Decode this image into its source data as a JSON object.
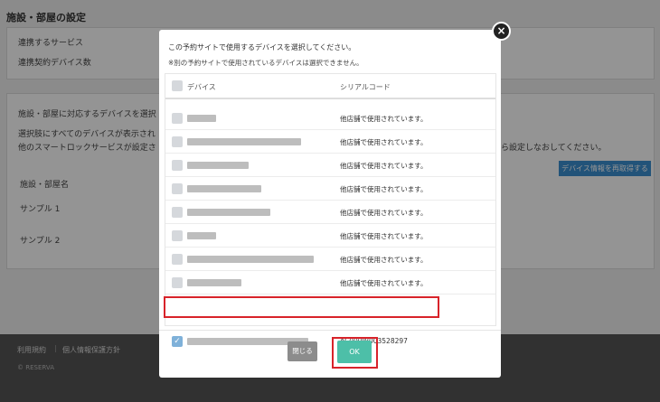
{
  "background": {
    "title": "施設・部屋の設定",
    "labels": {
      "linked_service": "連携するサービス",
      "linked_device_count": "連携契約デバイス数",
      "select_device_prompt": "施設・部屋に対応するデバイスを選択",
      "no_device_note_1": "選択肢にすべてのデバイスが表示され",
      "no_device_note_2": "他のスマートロックサービスが設定さ",
      "reconfigure_note": "ら設定しなおしてください。",
      "facility_room_name": "施設・部屋名",
      "sample1": "サンプル 1",
      "sample2": "サンプル 2"
    },
    "update_device_button": "デバイス情報を再取得する",
    "footer": {
      "terms": "利用規約",
      "privacy": "個人情報保護方針",
      "copyright": "© RESERVA"
    }
  },
  "modal": {
    "close_symbol": "×",
    "message_line1": "この予約サイトで使用するデバイスを選択してください。",
    "message_line2": "※別の予約サイトで使用されているデバイスは選択できません。",
    "header": {
      "device": "デバイス",
      "serial": "シリアルコード"
    },
    "rows": [
      {
        "status": "他店舗で使用されています。",
        "blur_width": 32
      },
      {
        "status": "他店舗で使用されています。",
        "blur_width": 126
      },
      {
        "status": "他店舗で使用されています。",
        "blur_width": 68
      },
      {
        "status": "他店舗で使用されています。",
        "blur_width": 82
      },
      {
        "status": "他店舗で使用されています。",
        "blur_width": 92
      },
      {
        "status": "他店舗で使用されています。",
        "blur_width": 32
      },
      {
        "status": "他店舗で使用されています。",
        "blur_width": 140
      },
      {
        "status": "他店舗で使用されています。",
        "blur_width": 60
      }
    ],
    "selected_row": {
      "serial": "AC000W003528297",
      "checked_symbol": "✓",
      "blur_width": 134
    },
    "buttons": {
      "close": "閉じる",
      "ok": "OK"
    }
  },
  "colors": {
    "highlight": "#d8232a",
    "ok_button": "#4dbfa8",
    "close_button": "#8c8c8c"
  }
}
